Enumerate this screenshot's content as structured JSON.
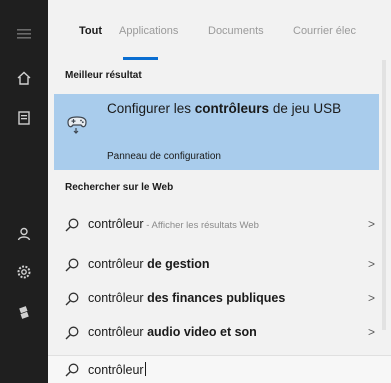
{
  "tabs": [
    {
      "label": "Tout",
      "active": true
    },
    {
      "label": "Applications",
      "active": false
    },
    {
      "label": "Documents",
      "active": false
    },
    {
      "label": "Courrier élec",
      "active": false
    }
  ],
  "best_match": {
    "section_title": "Meilleur résultat",
    "title_pre": "Configurer les ",
    "title_bold": "contrôleurs",
    "title_post": " de jeu USB",
    "subtitle": "Panneau de configuration",
    "icon": "game-controller-icon"
  },
  "web": {
    "section_title": "Rechercher sur le Web",
    "items": [
      {
        "plain": "contrôleur",
        "bold": "",
        "suffix": " - Afficher les résultats Web"
      },
      {
        "plain": "contrôleur",
        "bold": " de gestion",
        "suffix": ""
      },
      {
        "plain": "contrôleur",
        "bold": " des finances publiques",
        "suffix": ""
      },
      {
        "plain": "contrôleur",
        "bold": " audio video et son",
        "suffix": ""
      }
    ]
  },
  "search": {
    "value": "contrôleur"
  },
  "rail_icons": [
    "menu-icon",
    "home-icon",
    "documents-icon",
    "account-icon",
    "settings-icon",
    "power-icon"
  ],
  "colors": {
    "accent": "#0a6ed1",
    "highlight": "#a9ccec",
    "rail": "#1f1f1f",
    "panel": "#f2f2f2"
  }
}
